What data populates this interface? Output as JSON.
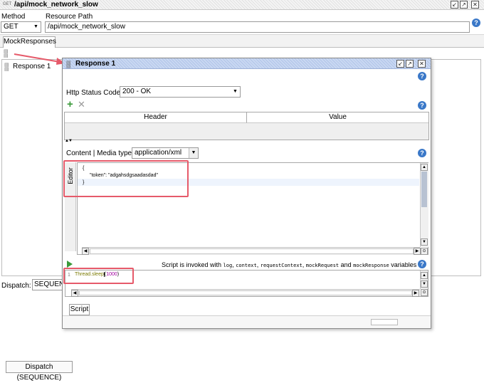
{
  "titlebar": {
    "badge": "GET",
    "title": "/api/mock_network_slow"
  },
  "method": {
    "label": "Method",
    "value": "GET"
  },
  "resource_path": {
    "label": "Resource Path",
    "value": "/api/mock_network_slow"
  },
  "tabs": {
    "mock_responses": "MockResponses"
  },
  "sidebar": {
    "items": [
      {
        "label": "Response 1"
      }
    ]
  },
  "dispatch": {
    "label": "Dispatch:",
    "value": "SEQUENCE",
    "value_short": "SEQUENC",
    "footer_button": "Dispatch (SEQUENCE)"
  },
  "response": {
    "title": "Response 1",
    "http_status": {
      "label": "Http Status Code:",
      "value": "200 - OK"
    },
    "headers_table": {
      "columns": [
        "Header",
        "Value"
      ]
    },
    "content": {
      "label": "Content | Media type:",
      "media_type": "application/xml",
      "editor_tab": "Editor"
    },
    "body_lines": [
      "{",
      "\"token\":   \"adgahsdgsaadasdad\"",
      "}"
    ],
    "script": {
      "description_parts": [
        {
          "text": "Script is invoked with ",
          "mono": false
        },
        {
          "text": "log",
          "mono": true
        },
        {
          "text": ", ",
          "mono": false
        },
        {
          "text": "context",
          "mono": true
        },
        {
          "text": ", ",
          "mono": false
        },
        {
          "text": "requestContext",
          "mono": true
        },
        {
          "text": ", ",
          "mono": false
        },
        {
          "text": "mockRequest",
          "mono": true
        },
        {
          "text": " and ",
          "mono": false
        },
        {
          "text": "mockResponse",
          "mono": true
        },
        {
          "text": " variables",
          "mono": false
        }
      ],
      "line_number": "1",
      "code_prefix": "Thread.sleep",
      "code_paren": "(",
      "code_number": "1000",
      "code_suffix": ")",
      "tab": "Script"
    }
  },
  "colors": {
    "accent": "#3a78c8",
    "highlight": "#e65a6a",
    "add_icon": "#3a9a3a",
    "code_keyword": "#7a7a00",
    "code_number": "#a000a0"
  }
}
